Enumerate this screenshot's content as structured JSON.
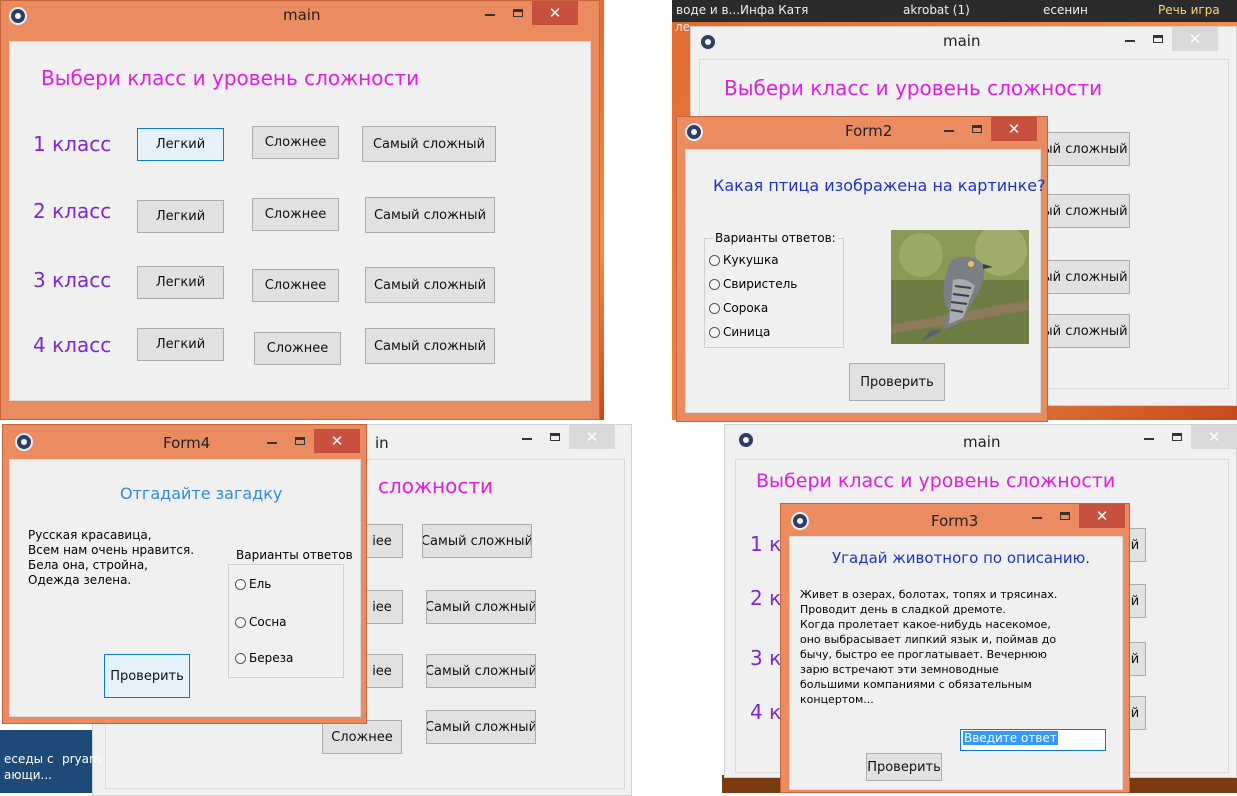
{
  "main": {
    "title": "main",
    "heading": "Выбери класс и уровень сложности",
    "grades": [
      "1 класс",
      "2 класс",
      "3 класс",
      "4 класс"
    ],
    "levels": [
      "Легкий",
      "Сложнее",
      "Самый сложный"
    ]
  },
  "close_glyph": "✕",
  "form2": {
    "title": "Form2",
    "question": "Какая птица изображена на картинке?",
    "group_label": "Варианты ответов:",
    "options": [
      "Кукушка",
      "Свиристель",
      "Сорока",
      "Синица"
    ],
    "check_button": "Проверить"
  },
  "form4": {
    "title": "Form4",
    "heading": "Отгадайте загадку",
    "riddle": [
      "Русская красавица,",
      "Всем нам очень нравится.",
      "Бела она, стройна,",
      "Одежда зелена."
    ],
    "group_label": "Варианты ответов",
    "options": [
      "Ель",
      "Сосна",
      "Береза"
    ],
    "check_button": "Проверить",
    "behind_title_fragment": "in",
    "behind_heading_fragment": "сложности",
    "behind_btn_fragment_1": "iee",
    "behind_btn_fragment_4": "Сложнее"
  },
  "form3": {
    "title": "Form3",
    "heading": "Угадай животного по описанию.",
    "description": [
      "Живет в озерах, болотах, топях и трясинах.",
      "Проводит день в сладкой дремоте.",
      "Когда пролетает какое-нибудь насекомое,",
      "оно выбрасывает липкий язык и, поймав до",
      "бычу, быстро ее проглатывает. Вечернюю",
      "зарю встречают эти земноводные",
      "большими компаниями с обязательным",
      "концертом..."
    ],
    "input_value": "Введите ответ",
    "check_button": "Проверить",
    "behind_grades": [
      "1 к",
      "2 к",
      "3 к",
      "4 к"
    ],
    "behind_btn": "й"
  },
  "form2_behind": {
    "btn_fragment": "ый сложный",
    "taskbar": [
      "воде и в...",
      "Инфа Катя",
      "akrobat (1)",
      "есенин",
      "Речь игра"
    ],
    "taskbar_side": "ле"
  },
  "desktop_bottom_left": [
    "еседы с",
    "pryam",
    "ающи..."
  ],
  "colors": {
    "title_bar": "#eb8c60",
    "heading": "#e01ee0",
    "grade": "#7d28d6",
    "question": "#1d33c8",
    "form4_heading": "#2e8de0",
    "close": "#c7503f"
  }
}
